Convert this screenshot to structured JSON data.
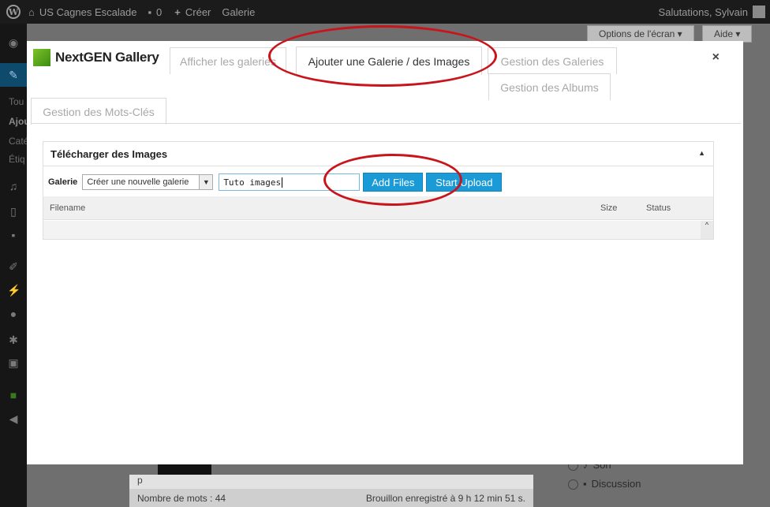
{
  "adminbar": {
    "wp_logo": "W",
    "site_name": "US Cagnes Escalade",
    "comments_count": "0",
    "new_label": "Créer",
    "gallery_label": "Galerie",
    "greeting": "Salutations, Sylvain"
  },
  "screen_options": {
    "options_label": "Options de l'écran ▾",
    "help_label": "Aide ▾"
  },
  "sidebar": {
    "partial_items": [
      "Tou",
      "Ajou",
      "Caté",
      "Étiq"
    ]
  },
  "modal": {
    "logo_text": "NextGEN Gallery",
    "close_label": "×",
    "tabs": [
      {
        "label": "Afficher les galeries",
        "active": false
      },
      {
        "label": "Ajouter une Galerie / des Images",
        "active": true
      },
      {
        "label": "Gestion des Galeries",
        "active": false
      },
      {
        "label": "Gestion des Albums",
        "active": false
      },
      {
        "label": "Gestion des Mots-Clés",
        "active": false
      }
    ]
  },
  "upload": {
    "title": "Télécharger des Images",
    "collapse_icon": "▲",
    "gallery_label": "Galerie",
    "gallery_select_value": "Créer une nouvelle galerie",
    "new_gallery_name": "Tuto images",
    "add_files_label": "Add Files",
    "start_upload_label": "Start Upload",
    "columns": {
      "filename": "Filename",
      "size": "Size",
      "status": "Status"
    }
  },
  "background": {
    "p_label": "p",
    "word_count": "Nombre de mots : 44",
    "draft_saved": "Brouillon enregistré à 9 h 12 min 51 s.",
    "radio_son": "Son",
    "radio_discussion": "Discussion"
  },
  "colors": {
    "accent_blue": "#1a9ad6",
    "annotation_red": "#c8141b",
    "logo_green": "#5aa61e"
  }
}
